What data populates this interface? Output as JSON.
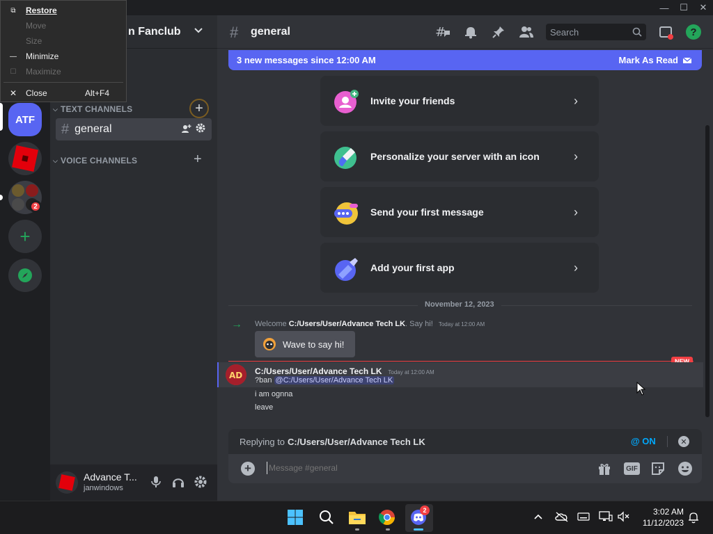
{
  "window": {
    "controls": {
      "minimize": "—",
      "maximize": "☐",
      "close": "✕"
    }
  },
  "system_menu": {
    "items": [
      {
        "label": "Restore",
        "shortcut": "",
        "icon": "restore-icon",
        "enabled": true
      },
      {
        "label": "Move",
        "shortcut": "",
        "icon": "",
        "enabled": false
      },
      {
        "label": "Size",
        "shortcut": "",
        "icon": "",
        "enabled": false
      },
      {
        "label": "Minimize",
        "shortcut": "",
        "icon": "minimize-icon",
        "enabled": true
      },
      {
        "label": "Maximize",
        "shortcut": "",
        "icon": "maximize-icon",
        "enabled": false
      },
      {
        "label": "Close",
        "shortcut": "Alt+F4",
        "icon": "close-icon",
        "enabled": true
      }
    ]
  },
  "server_rail": {
    "servers": [
      {
        "label": "ATF",
        "color": "#5865f2",
        "active": true
      },
      {
        "label": "",
        "color": "#e3000b"
      },
      {
        "label": "",
        "color": "#3b3d44",
        "badge": "2"
      }
    ],
    "add_label": "+",
    "explore_label": "explore"
  },
  "server": {
    "name": "n Fanclub"
  },
  "sidebar": {
    "categories": [
      {
        "label": "TEXT CHANNELS"
      },
      {
        "label": "VOICE CHANNELS"
      }
    ],
    "channels": [
      {
        "label": "general",
        "active": true
      }
    ]
  },
  "user": {
    "display_name": "Advance T...",
    "username": "janwindows"
  },
  "channel_header": {
    "name": "general",
    "search_placeholder": "Search"
  },
  "new_messages_banner": {
    "text": "3 new messages since 12:00 AM",
    "action": "Mark As Read"
  },
  "welcome_cards": [
    {
      "label": "Invite your friends",
      "icon": "invite-friends-icon"
    },
    {
      "label": "Personalize your server with an icon",
      "icon": "paintbrush-icon"
    },
    {
      "label": "Send your first message",
      "icon": "chat-bubble-icon"
    },
    {
      "label": "Add your first app",
      "icon": "app-icon"
    }
  ],
  "date_divider": "November 12, 2023",
  "system_message": {
    "prefix": "Welcome",
    "user": "C:/Users/User/Advance Tech LK",
    "suffix": ". Say hi!",
    "time": "Today at 12:00 AM",
    "wave_button": "Wave to say hi!"
  },
  "new_divider_label": "NEW",
  "message": {
    "author": "C:/Users/User/Advance Tech LK",
    "time": "Today at 12:00 AM",
    "line1_text": "?ban",
    "line1_mention": "@C:/Users/User/Advance Tech LK",
    "line2": "i am ognna",
    "line3": "leave"
  },
  "reply_bar": {
    "prefix": "Replying to",
    "target": "C:/Users/User/Advance Tech LK",
    "mention_toggle": "@ ON"
  },
  "composer": {
    "placeholder": "Message #general",
    "gif_label": "GIF"
  },
  "taskbar": {
    "discord_badge": "2",
    "time": "3:02 AM",
    "date": "11/12/2023"
  }
}
